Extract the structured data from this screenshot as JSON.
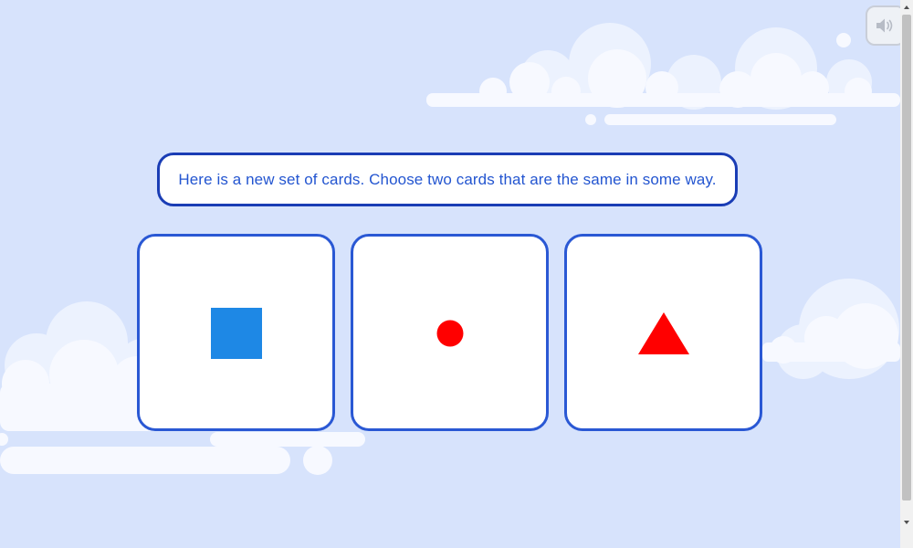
{
  "prompt": {
    "text": "Here is a new set of cards. Choose two cards that are the same in some way."
  },
  "cards": [
    {
      "shape": "square",
      "color": "#1e88e5"
    },
    {
      "shape": "circle",
      "color": "#ff0000"
    },
    {
      "shape": "triangle",
      "color": "#ff0000"
    }
  ],
  "sound_button": {
    "icon": "speaker-icon"
  },
  "colors": {
    "background": "#d7e3fc",
    "accent": "#2a58d4",
    "prompt_text": "#2355d0"
  }
}
